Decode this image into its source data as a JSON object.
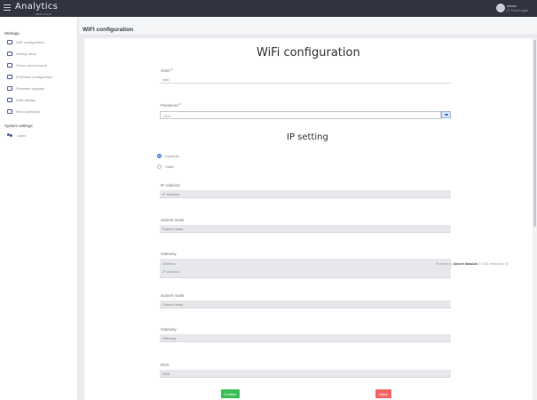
{
  "topbar": {
    "logo": "Analytics",
    "logo_sub": "WEB TOOLS",
    "user_name": "admin",
    "user_role": "IT Tech Login"
  },
  "sidebar": {
    "group_webapp": "Webapp",
    "webapp_items": [
      "WiFi configuration",
      "Setting mesh",
      "Server and protocol",
      "IFS/Mesh configuration",
      "Firmware upgrade",
      "Data display",
      "Files download"
    ],
    "group_system": "System settings",
    "system_items": [
      "Users"
    ]
  },
  "header": {
    "title": "WIFI configuration"
  },
  "wifi": {
    "title": "WiFi configuration",
    "ssid_label": "SSID",
    "ssid_value": "ssid",
    "password_label": "Password",
    "password_value": "••••••"
  },
  "ip": {
    "title": "IP setting",
    "mode_dynamic": "Dynamic",
    "mode_static": "Static",
    "ip_label": "IP Address",
    "ip_placeholder": "IP Address",
    "subnet_label": "Subnet mask",
    "subnet_placeholder": "Subnet mask",
    "gateway_label": "Gateway",
    "gateway_line1": "Address",
    "gateway_line2": "IP Address",
    "subnet2_label": "Subnet mask",
    "subnet2_placeholder": "Subnet mask",
    "gateway2_label": "Gateway",
    "gateway2_placeholder": "Gateway",
    "dns_label": "DNS",
    "dns_placeholder": "DNS"
  },
  "footer": {
    "powered_prefix": "Powered by",
    "powered_brand": "Absorb dataAsia",
    "powered_suffix": " © 2021 Innovation V2"
  },
  "buttons": {
    "confirm": "Confirm",
    "clear": "Clear"
  },
  "colors": {
    "topbar": "#2f3440",
    "accent": "#2f6fdc",
    "confirm": "#3cbf5a",
    "clear": "#f06a6a"
  }
}
